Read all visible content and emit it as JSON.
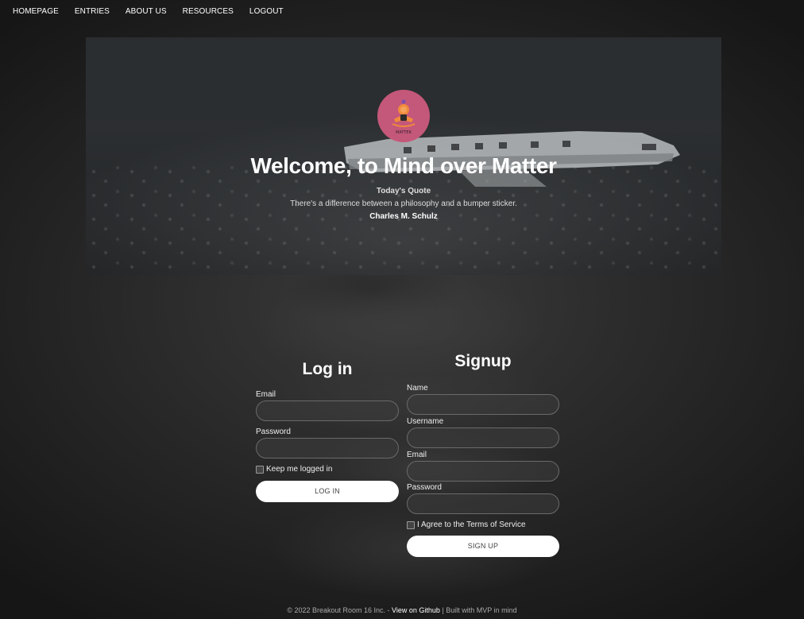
{
  "nav": {
    "items": [
      "HOMEPAGE",
      "ENTRIES",
      "ABOUT US",
      "RESOURCES",
      "LOGOUT"
    ]
  },
  "hero": {
    "logo_text": "MATTER",
    "title": "Welcome, to Mind over Matter",
    "quote_label": "Today's Quote",
    "quote_text": "There's a difference between a philosophy and a bumper sticker.",
    "quote_author": "Charles M. Schulz"
  },
  "login": {
    "heading": "Log in",
    "email_label": "Email",
    "password_label": "Password",
    "remember_label": "Keep me logged in",
    "button_label": "LOG IN"
  },
  "signup": {
    "heading": "Signup",
    "name_label": "Name",
    "username_label": "Username",
    "email_label": "Email",
    "password_label": "Password",
    "terms_label": "I Agree to the Terms of Service",
    "button_label": "SIGN UP"
  },
  "footer": {
    "copyright": "© 2022 Breakout Room 16 Inc. -",
    "github_link": "View on Github",
    "suffix": "| Built with MVP in mind"
  },
  "colors": {
    "logo_bg": "#c4587a",
    "button_bg": "#ffffff"
  }
}
